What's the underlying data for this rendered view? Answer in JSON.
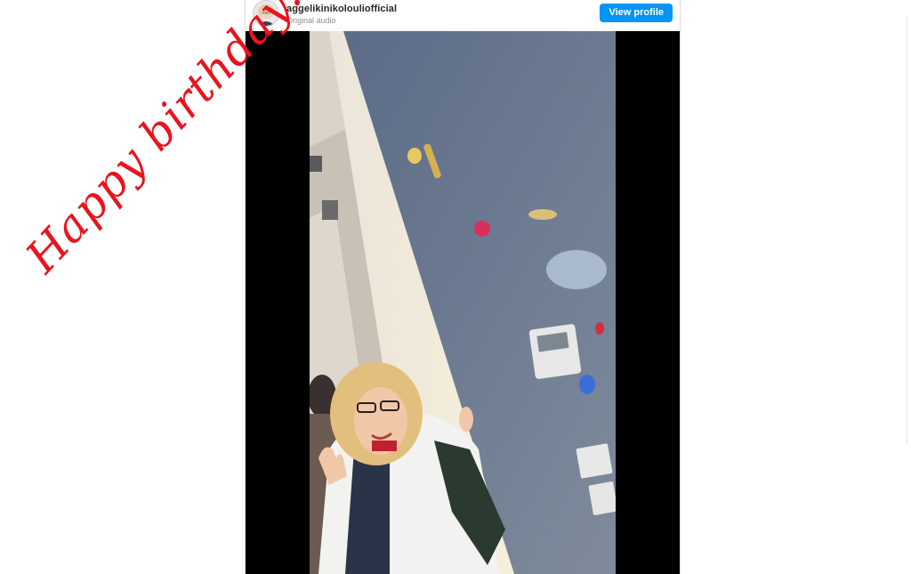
{
  "post": {
    "username": "aggelikinikolouliofficial",
    "subtitle": "Original audio",
    "view_profile_label": "View profile"
  },
  "overlay": {
    "greeting": "Happy birthday!"
  },
  "colors": {
    "button_blue": "#0095f6",
    "greeting_red": "#e8141e",
    "video_letterbox": "#000000"
  },
  "icons": {
    "avatar": "profile-avatar"
  }
}
